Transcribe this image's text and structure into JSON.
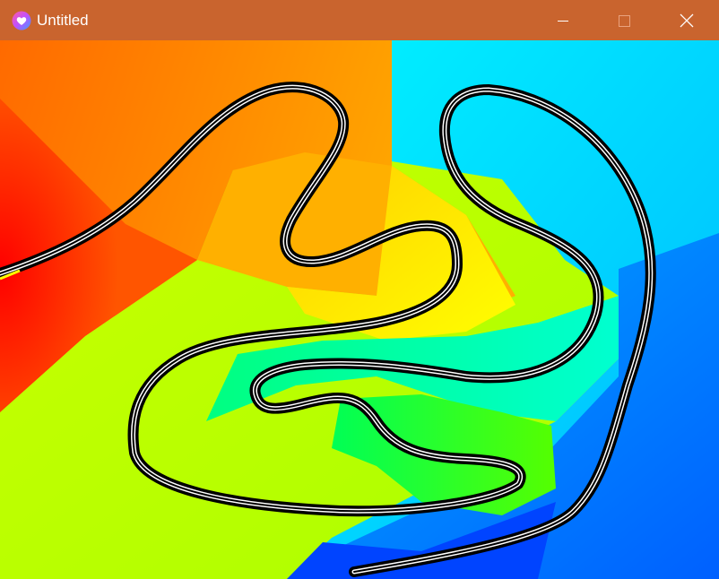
{
  "window": {
    "title": "Untitled",
    "title_bar_color": "#c9642e"
  },
  "titlebar_icons": {
    "app": "heart-app-icon",
    "minimize": "minimize-icon",
    "maximize": "maximize-icon",
    "close": "close-icon"
  },
  "canvas": {
    "background_regions": [
      {
        "name": "red",
        "color": "#ff1400"
      },
      {
        "name": "orange",
        "color": "#ff8a00"
      },
      {
        "name": "amber",
        "color": "#ffaa00"
      },
      {
        "name": "yellow",
        "color": "#ffee00"
      },
      {
        "name": "yellow-green",
        "color": "#ccff00"
      },
      {
        "name": "green",
        "color": "#33ff00"
      },
      {
        "name": "spring-green",
        "color": "#00ff88"
      },
      {
        "name": "cyan",
        "color": "#00ffff"
      },
      {
        "name": "azure",
        "color": "#00a0ff"
      },
      {
        "name": "blue",
        "color": "#0033ff"
      }
    ],
    "track": {
      "outer_color": "#000000",
      "inner_color": "#ffffff",
      "start_marker_color": "#ffff00"
    }
  }
}
